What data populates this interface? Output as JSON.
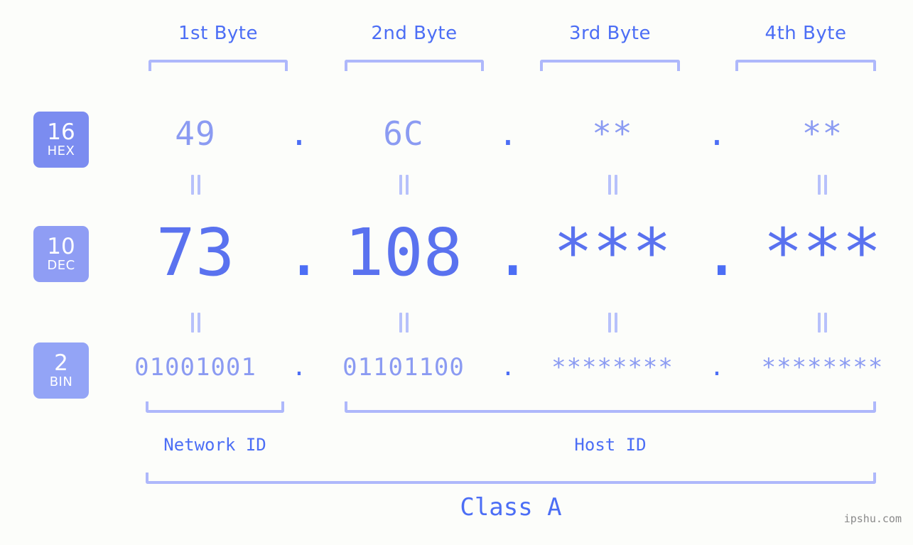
{
  "background_color": "#fcfdfa",
  "accent_color": "#4c6ef5",
  "accent_light_color": "#8b9bf2",
  "bracket_color": "#aeb8fb",
  "byte_headers": [
    {
      "label": "1st Byte"
    },
    {
      "label": "2nd Byte"
    },
    {
      "label": "3rd Byte"
    },
    {
      "label": "4th Byte"
    }
  ],
  "radix_badges": [
    {
      "number": "16",
      "unit": "HEX",
      "color": "#7b8cf0"
    },
    {
      "number": "10",
      "unit": "DEC",
      "color": "#8f9df4"
    },
    {
      "number": "2",
      "unit": "BIN",
      "color": "#93a4f6"
    }
  ],
  "rows": {
    "hex": {
      "bytes": [
        "49",
        "6C",
        "**",
        "**"
      ],
      "separator": "."
    },
    "dec": {
      "bytes": [
        "73",
        "108",
        "***",
        "***"
      ],
      "separator": "."
    },
    "bin": {
      "bytes": [
        "01001001",
        "01101100",
        "********",
        "********"
      ],
      "separator": "."
    }
  },
  "equality_marker": "||",
  "sections": {
    "network_id": "Network ID",
    "host_id": "Host ID",
    "class": "Class A"
  },
  "watermark": "ipshu.com"
}
